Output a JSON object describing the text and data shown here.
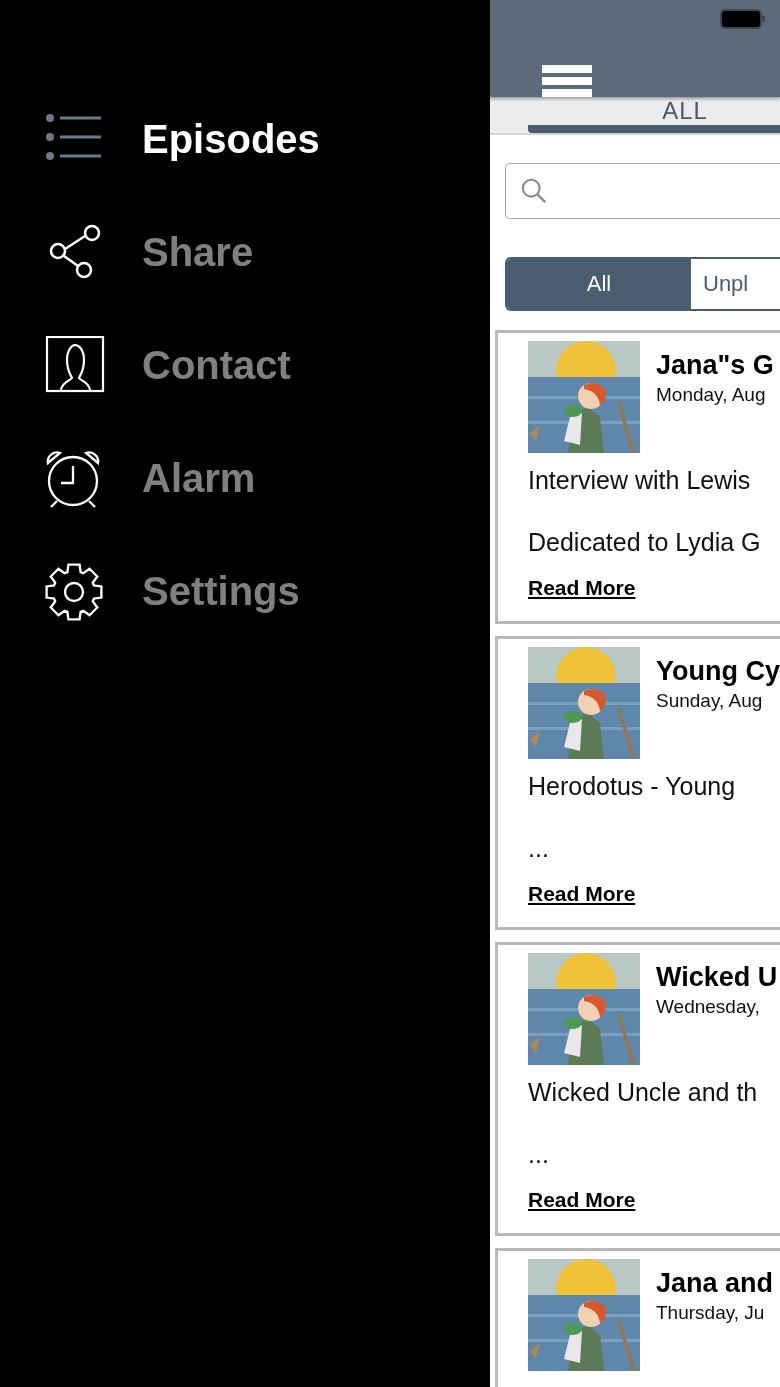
{
  "sidebar": {
    "items": [
      {
        "label": "Episodes",
        "kind": "list",
        "selected": true
      },
      {
        "label": "Share",
        "kind": "share",
        "selected": false
      },
      {
        "label": "Contact",
        "kind": "contact",
        "selected": false
      },
      {
        "label": "Alarm",
        "kind": "alarm",
        "selected": false
      },
      {
        "label": "Settings",
        "kind": "settings",
        "selected": false
      }
    ]
  },
  "tabs": [
    {
      "label": "ALL",
      "selected": true
    }
  ],
  "filter": [
    {
      "label": "All",
      "selected": true
    },
    {
      "label": "Unpl",
      "selected": false
    }
  ],
  "episodes": [
    {
      "title": "Jana\"s G",
      "date": "Monday, Aug",
      "lines": [
        "Interview with Lewis",
        "Dedicated to Lydia G"
      ],
      "link": "Read More"
    },
    {
      "title": "Young Cy",
      "date": "Sunday, Aug",
      "lines": [
        "Herodotus - Young",
        "..."
      ],
      "link": "Read More"
    },
    {
      "title": "Wicked U",
      "date": "Wednesday,",
      "lines": [
        "Wicked Uncle and th",
        "..."
      ],
      "link": "Read More"
    },
    {
      "title": "Jana and",
      "date": "Thursday, Ju"
    }
  ]
}
